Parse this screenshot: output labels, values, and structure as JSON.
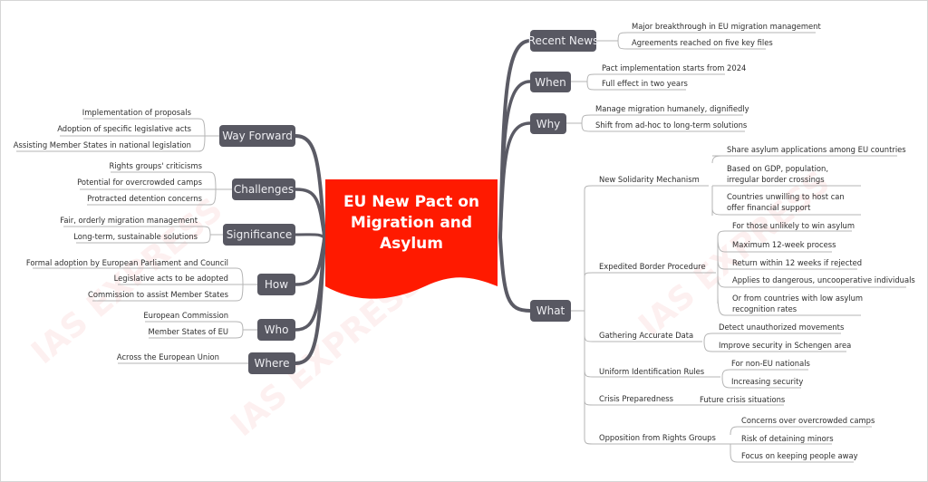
{
  "central": {
    "title": "EU New Pact on Migration and Asylum",
    "color": "#ff1a00"
  },
  "colors": {
    "node": "#585862",
    "branch": "#5b5b65",
    "leaf_line": "#b5b5b5"
  },
  "watermark": "IAS EXPRESS",
  "right": {
    "recent_news": {
      "label": "Recent News",
      "items": [
        "Major breakthrough in EU migration management",
        "Agreements reached on five key files"
      ]
    },
    "when": {
      "label": "When",
      "items": [
        "Pact implementation starts from 2024",
        "Full effect in two years"
      ]
    },
    "why": {
      "label": "Why",
      "items": [
        "Manage migration humanely, dignifiedly",
        "Shift from ad-hoc to long-term solutions"
      ]
    },
    "what": {
      "label": "What",
      "subtopics": [
        {
          "label": "New Solidarity Mechanism",
          "items": [
            "Share asylum applications among EU countries",
            "Based on GDP, population, irregular border crossings",
            "Countries unwilling to host can offer financial support"
          ]
        },
        {
          "label": "Expedited Border Procedure",
          "items": [
            "For those unlikely to win asylum",
            "Maximum 12-week process",
            "Return within 12 weeks if rejected",
            "Applies to dangerous, uncooperative individuals",
            "Or from countries with low asylum recognition rates"
          ]
        },
        {
          "label": "Gathering Accurate Data",
          "items": [
            "Detect unauthorized movements",
            "Improve security in Schengen area"
          ]
        },
        {
          "label": "Uniform Identification Rules",
          "items": [
            "For non-EU nationals",
            "Increasing security"
          ]
        },
        {
          "label": "Crisis Preparedness",
          "items": [
            "Future crisis situations"
          ]
        },
        {
          "label": "Opposition from Rights Groups",
          "items": [
            "Concerns over overcrowded camps",
            "Risk of detaining minors",
            "Focus on keeping people away"
          ]
        }
      ]
    }
  },
  "left": {
    "way_forward": {
      "label": "Way Forward",
      "items": [
        "Implementation of proposals",
        "Adoption of specific legislative acts",
        "Assisting Member States in national legislation"
      ]
    },
    "challenges": {
      "label": "Challenges",
      "items": [
        "Rights groups' criticisms",
        "Potential for overcrowded camps",
        "Protracted detention concerns"
      ]
    },
    "significance": {
      "label": "Significance",
      "items": [
        "Fair, orderly migration management",
        "Long-term, sustainable solutions"
      ]
    },
    "how": {
      "label": "How",
      "items": [
        "Formal adoption by European Parliament and Council",
        "Legislative acts to be adopted",
        "Commission to assist Member States"
      ]
    },
    "who": {
      "label": "Who",
      "items": [
        "European Commission",
        "Member States of EU"
      ]
    },
    "where": {
      "label": "Where",
      "items": [
        "Across the European Union"
      ]
    }
  }
}
